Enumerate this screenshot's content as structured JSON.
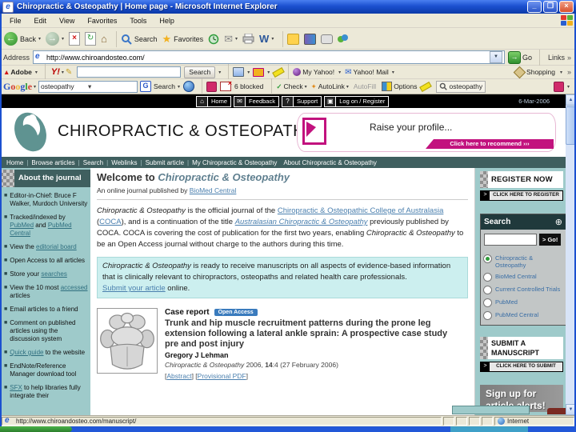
{
  "window": {
    "title": "Chiropractic & Osteopathy | Home page - Microsoft Internet Explorer"
  },
  "menu_bar": {
    "items": [
      "File",
      "Edit",
      "View",
      "Favorites",
      "Tools",
      "Help"
    ]
  },
  "toolbar": {
    "back_label": "Back",
    "search_label": "Search",
    "favorites_label": "Favorites"
  },
  "address_bar": {
    "label": "Address",
    "value": "http://www.chiroandosteo.com/",
    "go_label": "Go",
    "links_label": "Links"
  },
  "adobe_bar": {
    "adobe_label": "Adobe",
    "yahoo_logo": "Y!",
    "search_value": "",
    "search_label": "Search",
    "my_yahoo_label": "My Yahoo!",
    "yahoo_mail_label": "Yahoo! Mail",
    "shopping_label": "Shopping"
  },
  "google_bar": {
    "query": "osteopathy",
    "search_label": "Search",
    "blocked_label": "6 blocked",
    "check_label": "Check",
    "autolink_label": "AutoLink",
    "autofill_label": "AutoFill",
    "options_label": "Options",
    "highlight_word": "osteopathy"
  },
  "site_topbar": {
    "buttons": [
      "Home",
      "Feedback",
      "Support",
      "Log on / Register"
    ],
    "date": "6-Mar-2006"
  },
  "header": {
    "logo_text": "CHIROPRACTIC & OSTEOPATHY",
    "banner": {
      "title": "Raise your profile...",
      "cta": "Click here to recommend",
      "arrows": "›››"
    }
  },
  "nav": {
    "items": [
      "Home",
      "Browse articles",
      "Search",
      "Weblinks",
      "Submit article",
      "My Chiropractic & Osteopathy",
      "About Chiropractic & Osteopathy"
    ]
  },
  "sidebar": {
    "title": "About the journal",
    "items": [
      [
        {
          "t": "Editor-in-Chief: Bruce F Walker, Murdoch University"
        }
      ],
      [
        {
          "t": "Tracked/indexed by "
        },
        {
          "t": "PubMed",
          "link": true
        },
        {
          "t": " and "
        },
        {
          "t": "PubMed Central",
          "link": true
        }
      ],
      [
        {
          "t": "View the "
        },
        {
          "t": "editorial board",
          "link": true
        }
      ],
      [
        {
          "t": "Open Access to all articles"
        }
      ],
      [
        {
          "t": "Store your "
        },
        {
          "t": "searches",
          "link": true
        }
      ],
      [
        {
          "t": "View the 10 most "
        },
        {
          "t": "accessed",
          "link": true
        },
        {
          "t": " articles"
        }
      ],
      [
        {
          "t": "Email articles to a friend"
        }
      ],
      [
        {
          "t": "Comment on published articles using the discussion system"
        }
      ],
      [
        {
          "t": "Quick guide",
          "link": true
        },
        {
          "t": " to the website"
        }
      ],
      [
        {
          "t": "EndNote/Reference Manager download tool"
        }
      ],
      [
        {
          "t": "SFX",
          "link": true
        },
        {
          "t": " to help libraries fully integrate their"
        }
      ]
    ]
  },
  "main": {
    "welcome": [
      {
        "t": "Welcome to "
      },
      {
        "t": "Chiropractic & Osteopathy",
        "i": true
      }
    ],
    "subtitle": [
      {
        "t": "An online journal published by "
      },
      {
        "t": "BioMed Central",
        "link": true
      }
    ],
    "intro": [
      {
        "t": "Chiropractic & Osteopathy",
        "i": true
      },
      {
        "t": " is the official journal of the "
      },
      {
        "t": "Chiropractic & Osteopathic College of Australasia",
        "link": true
      },
      {
        "t": " ("
      },
      {
        "t": "COCA",
        "link": true
      },
      {
        "t": "), and is a continuation of the title "
      },
      {
        "t": "Australasian Chiropractic & Osteopathy",
        "link": true,
        "i": true
      },
      {
        "t": " previously published by COCA. COCA is covering the cost of publication for the first two years, enabling "
      },
      {
        "t": "Chiropractic & Osteopathy",
        "i": true
      },
      {
        "t": " to be an Open Access journal without charge to the authors during this time."
      }
    ],
    "callout": [
      {
        "t": "Chiropractic & Osteopathy",
        "i": true
      },
      {
        "t": " is ready to receive manuscripts on all aspects of evidence-based information that is clinically relevant to chiropractors, osteopaths and related health care professionals."
      },
      {
        "br": true
      },
      {
        "t": "Submit your article",
        "link": true
      },
      {
        "t": " online."
      }
    ],
    "article": {
      "label": "Case report",
      "badge": "Open Access",
      "title": "Trunk and hip muscle recruitment patterns during the prone leg extension following a lateral ankle sprain: A prospective case study pre and post injury",
      "author": "Gregory J Lehman",
      "citation": [
        {
          "t": "Chiropractic & Osteopathy",
          "i": true
        },
        {
          "t": " 2006, "
        },
        {
          "t": "14",
          "b": true
        },
        {
          "t": ":4 (27 February 2006)"
        }
      ],
      "links": [
        {
          "t": "["
        },
        {
          "t": "Abstract",
          "link": true
        },
        {
          "t": "] ["
        },
        {
          "t": "Provisional PDF",
          "link": true
        },
        {
          "t": "]"
        }
      ]
    }
  },
  "right_rail": {
    "register_title": "REGISTER NOW",
    "register_cta": "CLICK HERE TO REGISTER",
    "search": {
      "title": "Search",
      "go_label": "> Go!",
      "options": [
        "Chiropractic & Osteopathy",
        "BioMed Central",
        "Current Controlled Trials",
        "PubMed",
        "PubMed Central"
      ],
      "selected_index": 0
    },
    "submit_title": "SUBMIT A MANUSCRIPT",
    "submit_cta": "CLICK HERE TO SUBMIT",
    "alerts_line1": "Sign up for",
    "alerts_line2": "article alerts!"
  },
  "status_bar": {
    "url": "http://www.chiroandosteo.com/manuscript/",
    "zone": "Internet"
  },
  "colors": {
    "rail_teal": "#9ecaca",
    "nav_teal": "#3f5f5f",
    "magenta": "#c2127e",
    "badge_blue": "#3a7bbd",
    "link_blue": "#4a7fae",
    "callout_teal": "#ccefef"
  }
}
